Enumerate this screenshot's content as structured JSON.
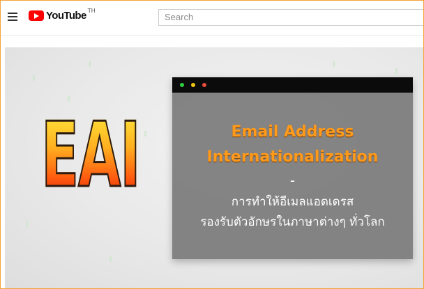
{
  "header": {
    "logo_text": "YouTube",
    "region": "TH",
    "search_placeholder": "Search"
  },
  "video": {
    "acronym": "EAI",
    "title_line1": "Email Address",
    "title_line2": "Internationalization",
    "separator": "-",
    "thai_line1": "การทำให้อีเมลแอดเดรส",
    "thai_line2": "รองรับตัวอักษรในภาษาต่างๆ ทั่วโลก"
  },
  "colors": {
    "accent_orange": "#ff9a1a",
    "youtube_red": "#ff0000",
    "frame_border": "#f3a33a"
  },
  "icons": [
    "menu-icon",
    "youtube-play-icon",
    "window-close-dot",
    "window-minimize-dot",
    "window-maximize-dot"
  ]
}
